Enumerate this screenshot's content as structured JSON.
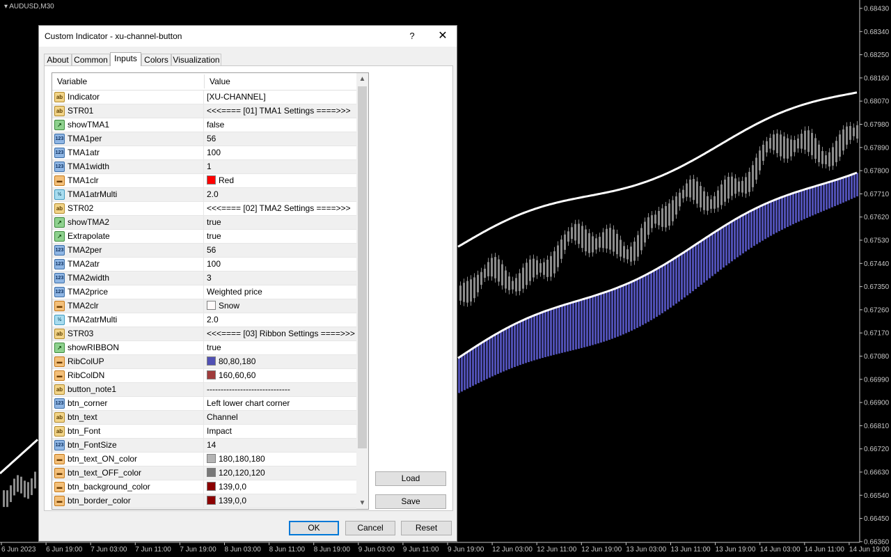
{
  "chart": {
    "symbol_label": "AUDUSD,M30",
    "price_ticks": [
      "0.68430",
      "0.68340",
      "0.68250",
      "0.68160",
      "0.68070",
      "0.67980",
      "0.67890",
      "0.67800",
      "0.67710",
      "0.67620",
      "0.67530",
      "0.67440",
      "0.67350",
      "0.67260",
      "0.67170",
      "0.67080",
      "0.66990",
      "0.66900",
      "0.66810",
      "0.66720",
      "0.66630",
      "0.66540",
      "0.66450",
      "0.66360"
    ],
    "time_ticks": [
      "6 Jun 2023",
      "6 Jun 19:00",
      "7 Jun 03:00",
      "7 Jun 11:00",
      "7 Jun 19:00",
      "8 Jun 03:00",
      "8 Jun 11:00",
      "8 Jun 19:00",
      "9 Jun 03:00",
      "9 Jun 11:00",
      "9 Jun 19:00",
      "12 Jun 03:00",
      "12 Jun 11:00",
      "12 Jun 19:00",
      "13 Jun 03:00",
      "13 Jun 11:00",
      "13 Jun 19:00",
      "14 Jun 03:00",
      "14 Jun 11:00",
      "14 Jun 19:00"
    ],
    "colors": {
      "background": "#000000",
      "candle": "#8c8c8c",
      "band": "#ffffff",
      "ribbon": "#5050b4"
    }
  },
  "dialog": {
    "title": "Custom Indicator - xu-channel-button",
    "help_label": "?",
    "close_label": "✕",
    "tabs": [
      {
        "label": "About",
        "active": false
      },
      {
        "label": "Common",
        "active": false
      },
      {
        "label": "Inputs",
        "active": true
      },
      {
        "label": "Colors",
        "active": false
      },
      {
        "label": "Visualization",
        "active": false
      }
    ],
    "grid": {
      "col_variable": "Variable",
      "col_value": "Value",
      "rows": [
        {
          "type": "ab",
          "name": "Indicator",
          "value": "[XU-CHANNEL]"
        },
        {
          "type": "ab",
          "name": "STR01",
          "value": "<<<==== [01] TMA1 Settings ====>>>"
        },
        {
          "type": "bool",
          "name": "showTMA1",
          "value": "false"
        },
        {
          "type": "123",
          "name": "TMA1per",
          "value": "56"
        },
        {
          "type": "123",
          "name": "TMA1atr",
          "value": "100"
        },
        {
          "type": "123",
          "name": "TMA1width",
          "value": "1"
        },
        {
          "type": "color",
          "name": "TMA1clr",
          "value": "Red",
          "swatch": "#ff0000"
        },
        {
          "type": "dbl",
          "name": "TMA1atrMulti",
          "value": "2.0"
        },
        {
          "type": "ab",
          "name": "STR02",
          "value": "<<<==== [02] TMA2 Settings ====>>>"
        },
        {
          "type": "bool",
          "name": "showTMA2",
          "value": "true"
        },
        {
          "type": "bool",
          "name": "Extrapolate",
          "value": "true"
        },
        {
          "type": "123",
          "name": "TMA2per",
          "value": "56"
        },
        {
          "type": "123",
          "name": "TMA2atr",
          "value": "100"
        },
        {
          "type": "123",
          "name": "TMA2width",
          "value": "3"
        },
        {
          "type": "123",
          "name": "TMA2price",
          "value": "Weighted price"
        },
        {
          "type": "color",
          "name": "TMA2clr",
          "value": "Snow",
          "swatch": "#fffafa"
        },
        {
          "type": "dbl",
          "name": "TMA2atrMulti",
          "value": "2.0"
        },
        {
          "type": "ab",
          "name": "STR03",
          "value": "<<<==== [03] Ribbon Settings ====>>>"
        },
        {
          "type": "bool",
          "name": "showRIBBON",
          "value": "true"
        },
        {
          "type": "color",
          "name": "RibColUP",
          "value": "80,80,180",
          "swatch": "#5050b4"
        },
        {
          "type": "color",
          "name": "RibColDN",
          "value": "160,60,60",
          "swatch": "#a03c3c"
        },
        {
          "type": "ab",
          "name": "button_note1",
          "value": "------------------------------"
        },
        {
          "type": "123",
          "name": "btn_corner",
          "value": "Left lower chart corner"
        },
        {
          "type": "ab",
          "name": "btn_text",
          "value": "Channel"
        },
        {
          "type": "ab",
          "name": "btn_Font",
          "value": "Impact"
        },
        {
          "type": "123",
          "name": "btn_FontSize",
          "value": "14"
        },
        {
          "type": "color",
          "name": "btn_text_ON_color",
          "value": "180,180,180",
          "swatch": "#b4b4b4"
        },
        {
          "type": "color",
          "name": "btn_text_OFF_color",
          "value": "120,120,120",
          "swatch": "#787878"
        },
        {
          "type": "color",
          "name": "btn_background_color",
          "value": "139,0,0",
          "swatch": "#8b0000"
        },
        {
          "type": "color",
          "name": "btn_border_color",
          "value": "139,0,0",
          "swatch": "#8b0000"
        }
      ]
    },
    "icons": {
      "ab": "ab",
      "123": "123",
      "bool": "↗",
      "color": "▬",
      "dbl": "½"
    },
    "buttons": {
      "load": "Load",
      "save": "Save",
      "ok": "OK",
      "cancel": "Cancel",
      "reset": "Reset"
    }
  }
}
